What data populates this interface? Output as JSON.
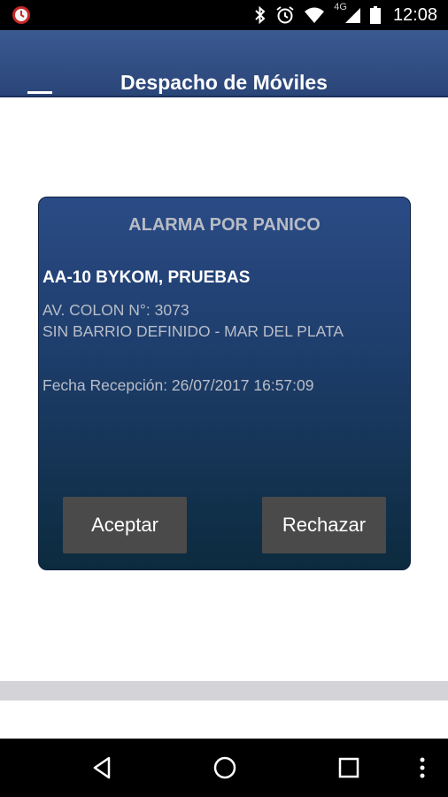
{
  "statusbar": {
    "network": "4G",
    "time": "12:08"
  },
  "app": {
    "title": "Despacho de Móviles"
  },
  "dialog": {
    "title": "ALARMA POR PANICO",
    "unit": "AA-10 BYKOM, PRUEBAS",
    "address": "AV. COLON N°: 3073",
    "barrio": "SIN BARRIO DEFINIDO - MAR DEL PLATA",
    "fecha": "Fecha Recepción: 26/07/2017 16:57:09",
    "accept_label": "Aceptar",
    "reject_label": "Rechazar"
  },
  "icons": {
    "status": [
      "app-alarm-icon",
      "bluetooth-icon",
      "alarm-clock-icon",
      "wifi-icon",
      "signal-icon",
      "battery-icon"
    ],
    "nav": [
      "back-icon",
      "home-icon",
      "recent-apps-icon",
      "overflow-menu-icon"
    ]
  },
  "colors": {
    "appbar": "#2f4e86",
    "dialog_top": "#2b4b86",
    "dialog_bottom": "#0c2b3e",
    "button": "#4a4a4a"
  }
}
